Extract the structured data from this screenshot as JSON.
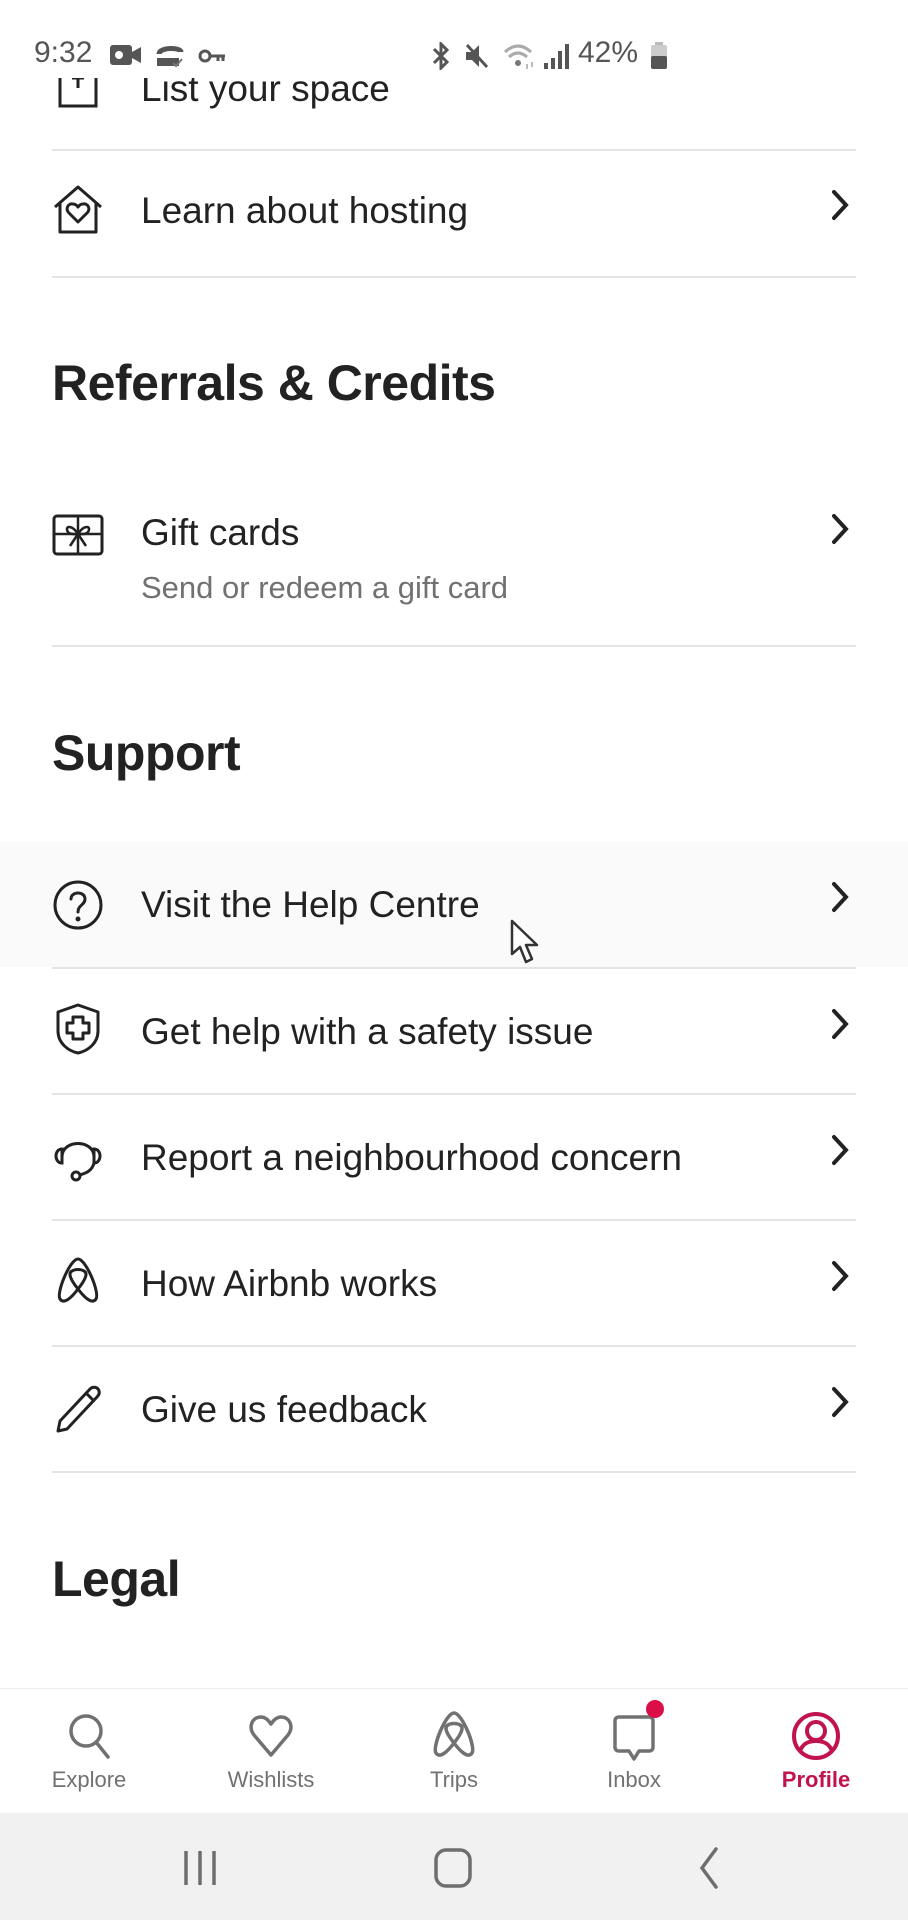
{
  "status_bar": {
    "time": "9:32",
    "battery_percent": "42%",
    "icons": [
      "video-call-icon",
      "sync-icon",
      "vpn-key-icon",
      "bluetooth-icon",
      "mute-icon",
      "wifi-icon",
      "signal-icon",
      "battery-icon"
    ]
  },
  "partial_item": {
    "label": "List your space",
    "icon": "plus-square-icon"
  },
  "hosting": {
    "items": [
      {
        "label": "Learn about hosting",
        "icon": "house-heart-icon"
      }
    ]
  },
  "referrals": {
    "heading": "Referrals & Credits",
    "items": [
      {
        "label": "Gift cards",
        "subtitle": "Send or redeem a gift card",
        "icon": "gift-card-icon"
      }
    ]
  },
  "support": {
    "heading": "Support",
    "items": [
      {
        "label": "Visit the Help Centre",
        "icon": "question-circle-icon"
      },
      {
        "label": "Get help with a safety issue",
        "icon": "shield-cross-icon"
      },
      {
        "label": "Report a neighbourhood concern",
        "icon": "headset-icon"
      },
      {
        "label": "How Airbnb works",
        "icon": "airbnb-logo-icon"
      },
      {
        "label": "Give us feedback",
        "icon": "pencil-icon"
      }
    ]
  },
  "legal": {
    "heading": "Legal"
  },
  "bottom_nav": {
    "active": "Profile",
    "accent_color": "#c1134e",
    "items": [
      {
        "label": "Explore",
        "icon": "search-icon"
      },
      {
        "label": "Wishlists",
        "icon": "heart-icon"
      },
      {
        "label": "Trips",
        "icon": "airbnb-logo-icon"
      },
      {
        "label": "Inbox",
        "icon": "message-icon",
        "badge": true
      },
      {
        "label": "Profile",
        "icon": "user-circle-icon"
      }
    ]
  },
  "system_nav": {
    "buttons": [
      "recent-apps",
      "home",
      "back"
    ]
  }
}
